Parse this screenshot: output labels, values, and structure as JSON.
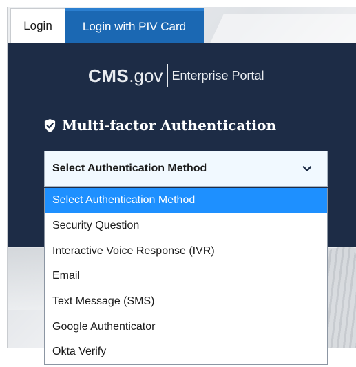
{
  "tabs": [
    {
      "label": "Login"
    },
    {
      "label": "Login with PIV Card"
    }
  ],
  "logo": {
    "brand": "CMS",
    "domain": ".gov",
    "portal": "Enterprise Portal"
  },
  "mfa": {
    "heading": "Multi-factor Authentication",
    "icon": "shield-check-icon"
  },
  "select": {
    "value": "Select Authentication Method",
    "icon": "chevron-down-icon",
    "options": [
      "Select Authentication Method",
      "Security Question",
      "Interactive Voice Response (IVR)",
      "Email",
      "Text Message (SMS)",
      "Google Authenticator",
      "Okta Verify"
    ],
    "selected_index": 0
  },
  "colors": {
    "panel": "#1d2c46",
    "tab_active": "#1b68b3",
    "highlight": "#1e90ff"
  }
}
